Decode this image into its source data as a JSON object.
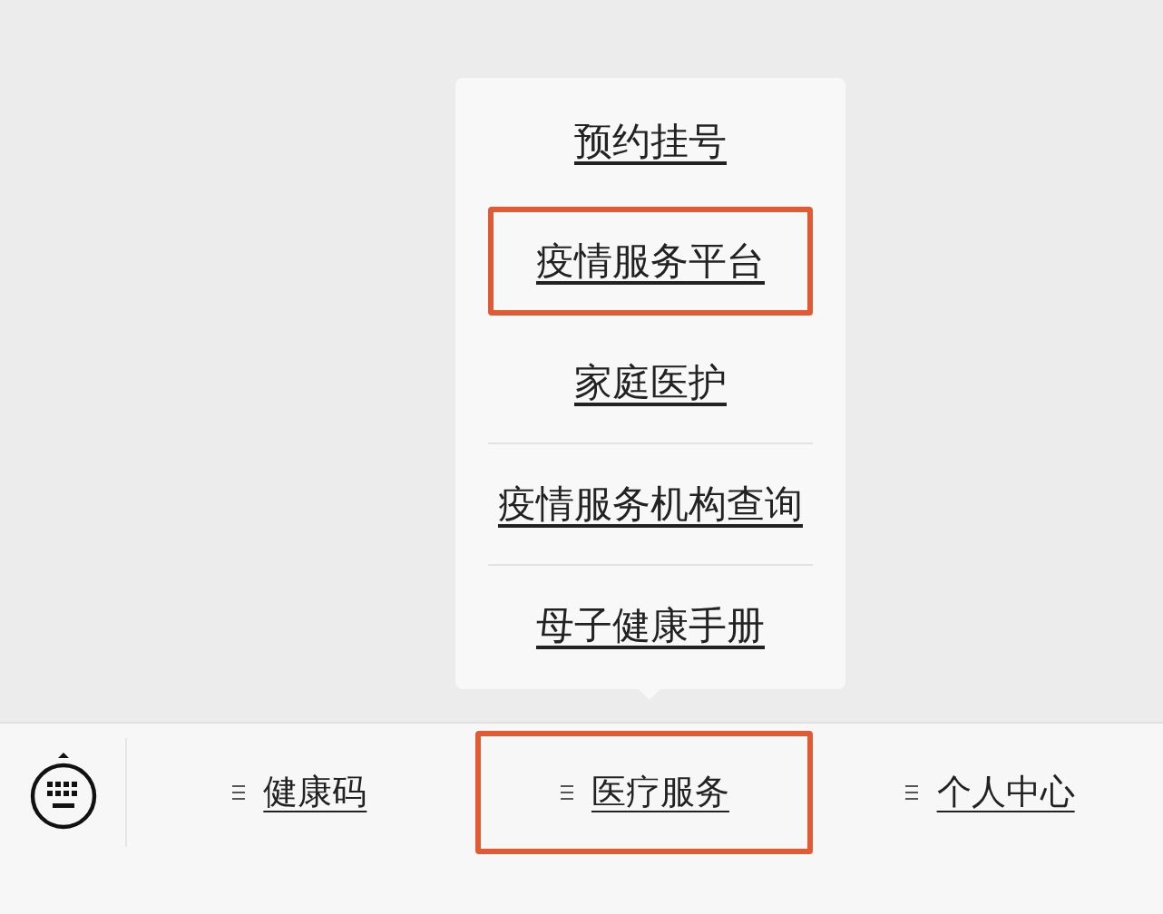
{
  "submenu": {
    "items": [
      {
        "label": "预约挂号",
        "highlighted": false
      },
      {
        "label": "疫情服务平台",
        "highlighted": true
      },
      {
        "label": "家庭医护",
        "highlighted": false
      },
      {
        "label": "疫情服务机构查询",
        "highlighted": false
      },
      {
        "label": "母子健康手册",
        "highlighted": false
      }
    ]
  },
  "menu_bar": {
    "items": [
      {
        "label": "健康码",
        "highlighted": false
      },
      {
        "label": "医疗服务",
        "highlighted": true
      },
      {
        "label": "个人中心",
        "highlighted": false
      }
    ]
  }
}
